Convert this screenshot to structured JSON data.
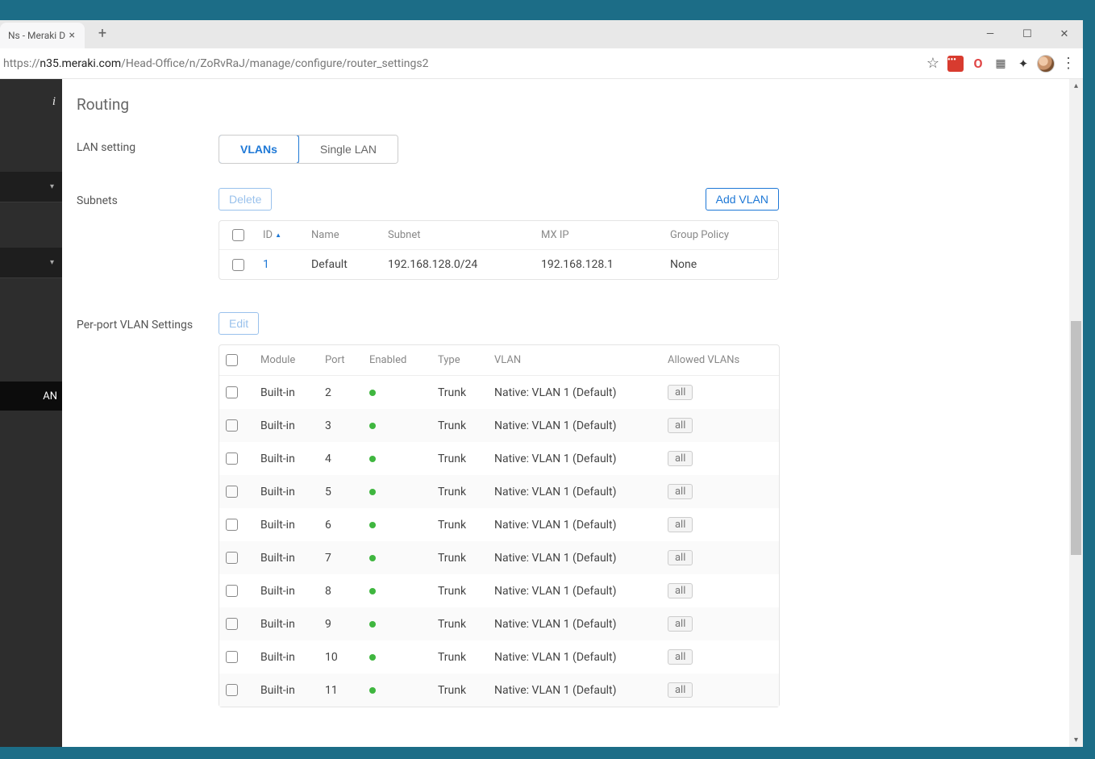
{
  "browser": {
    "tab_title": "Ns - Meraki D",
    "url_proto": "https://",
    "url_host": "n35.meraki.com",
    "url_path": "/Head-Office/n/ZoRvRaJ/manage/configure/router_settings2"
  },
  "sidebar": {
    "brand_fragment": "i",
    "active_item": "AN"
  },
  "page": {
    "title": "Routing",
    "lan_setting_label": "LAN setting",
    "tabs": {
      "vlans": "VLANs",
      "single_lan": "Single LAN",
      "active": "vlans"
    },
    "subnets": {
      "label": "Subnets",
      "delete_btn": "Delete",
      "add_btn": "Add VLAN",
      "columns": {
        "id": "ID",
        "name": "Name",
        "subnet": "Subnet",
        "mxip": "MX IP",
        "group_policy": "Group Policy"
      },
      "rows": [
        {
          "id": "1",
          "name": "Default",
          "subnet": "192.168.128.0/24",
          "mxip": "192.168.128.1",
          "group_policy": "None"
        }
      ]
    },
    "ports": {
      "label": "Per-port VLAN Settings",
      "edit_btn": "Edit",
      "columns": {
        "module": "Module",
        "port": "Port",
        "enabled": "Enabled",
        "type": "Type",
        "vlan": "VLAN",
        "allowed": "Allowed VLANs"
      },
      "rows": [
        {
          "module": "Built-in",
          "port": "2",
          "type": "Trunk",
          "vlan": "Native: VLAN 1 (Default)",
          "allowed": "all"
        },
        {
          "module": "Built-in",
          "port": "3",
          "type": "Trunk",
          "vlan": "Native: VLAN 1 (Default)",
          "allowed": "all"
        },
        {
          "module": "Built-in",
          "port": "4",
          "type": "Trunk",
          "vlan": "Native: VLAN 1 (Default)",
          "allowed": "all"
        },
        {
          "module": "Built-in",
          "port": "5",
          "type": "Trunk",
          "vlan": "Native: VLAN 1 (Default)",
          "allowed": "all"
        },
        {
          "module": "Built-in",
          "port": "6",
          "type": "Trunk",
          "vlan": "Native: VLAN 1 (Default)",
          "allowed": "all"
        },
        {
          "module": "Built-in",
          "port": "7",
          "type": "Trunk",
          "vlan": "Native: VLAN 1 (Default)",
          "allowed": "all"
        },
        {
          "module": "Built-in",
          "port": "8",
          "type": "Trunk",
          "vlan": "Native: VLAN 1 (Default)",
          "allowed": "all"
        },
        {
          "module": "Built-in",
          "port": "9",
          "type": "Trunk",
          "vlan": "Native: VLAN 1 (Default)",
          "allowed": "all"
        },
        {
          "module": "Built-in",
          "port": "10",
          "type": "Trunk",
          "vlan": "Native: VLAN 1 (Default)",
          "allowed": "all"
        },
        {
          "module": "Built-in",
          "port": "11",
          "type": "Trunk",
          "vlan": "Native: VLAN 1 (Default)",
          "allowed": "all"
        }
      ]
    }
  }
}
